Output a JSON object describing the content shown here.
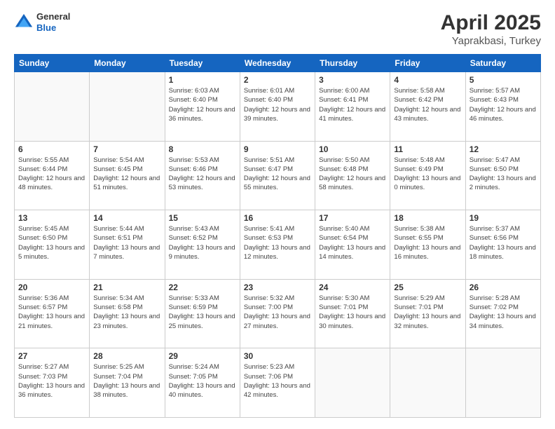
{
  "header": {
    "logo": {
      "general": "General",
      "blue": "Blue"
    },
    "title": "April 2025",
    "subtitle": "Yaprakbasi, Turkey"
  },
  "calendar": {
    "days_of_week": [
      "Sunday",
      "Monday",
      "Tuesday",
      "Wednesday",
      "Thursday",
      "Friday",
      "Saturday"
    ],
    "weeks": [
      [
        {
          "day": "",
          "empty": true
        },
        {
          "day": "",
          "empty": true
        },
        {
          "day": "1",
          "sunrise": "Sunrise: 6:03 AM",
          "sunset": "Sunset: 6:40 PM",
          "daylight": "Daylight: 12 hours and 36 minutes."
        },
        {
          "day": "2",
          "sunrise": "Sunrise: 6:01 AM",
          "sunset": "Sunset: 6:40 PM",
          "daylight": "Daylight: 12 hours and 39 minutes."
        },
        {
          "day": "3",
          "sunrise": "Sunrise: 6:00 AM",
          "sunset": "Sunset: 6:41 PM",
          "daylight": "Daylight: 12 hours and 41 minutes."
        },
        {
          "day": "4",
          "sunrise": "Sunrise: 5:58 AM",
          "sunset": "Sunset: 6:42 PM",
          "daylight": "Daylight: 12 hours and 43 minutes."
        },
        {
          "day": "5",
          "sunrise": "Sunrise: 5:57 AM",
          "sunset": "Sunset: 6:43 PM",
          "daylight": "Daylight: 12 hours and 46 minutes."
        }
      ],
      [
        {
          "day": "6",
          "sunrise": "Sunrise: 5:55 AM",
          "sunset": "Sunset: 6:44 PM",
          "daylight": "Daylight: 12 hours and 48 minutes."
        },
        {
          "day": "7",
          "sunrise": "Sunrise: 5:54 AM",
          "sunset": "Sunset: 6:45 PM",
          "daylight": "Daylight: 12 hours and 51 minutes."
        },
        {
          "day": "8",
          "sunrise": "Sunrise: 5:53 AM",
          "sunset": "Sunset: 6:46 PM",
          "daylight": "Daylight: 12 hours and 53 minutes."
        },
        {
          "day": "9",
          "sunrise": "Sunrise: 5:51 AM",
          "sunset": "Sunset: 6:47 PM",
          "daylight": "Daylight: 12 hours and 55 minutes."
        },
        {
          "day": "10",
          "sunrise": "Sunrise: 5:50 AM",
          "sunset": "Sunset: 6:48 PM",
          "daylight": "Daylight: 12 hours and 58 minutes."
        },
        {
          "day": "11",
          "sunrise": "Sunrise: 5:48 AM",
          "sunset": "Sunset: 6:49 PM",
          "daylight": "Daylight: 13 hours and 0 minutes."
        },
        {
          "day": "12",
          "sunrise": "Sunrise: 5:47 AM",
          "sunset": "Sunset: 6:50 PM",
          "daylight": "Daylight: 13 hours and 2 minutes."
        }
      ],
      [
        {
          "day": "13",
          "sunrise": "Sunrise: 5:45 AM",
          "sunset": "Sunset: 6:50 PM",
          "daylight": "Daylight: 13 hours and 5 minutes."
        },
        {
          "day": "14",
          "sunrise": "Sunrise: 5:44 AM",
          "sunset": "Sunset: 6:51 PM",
          "daylight": "Daylight: 13 hours and 7 minutes."
        },
        {
          "day": "15",
          "sunrise": "Sunrise: 5:43 AM",
          "sunset": "Sunset: 6:52 PM",
          "daylight": "Daylight: 13 hours and 9 minutes."
        },
        {
          "day": "16",
          "sunrise": "Sunrise: 5:41 AM",
          "sunset": "Sunset: 6:53 PM",
          "daylight": "Daylight: 13 hours and 12 minutes."
        },
        {
          "day": "17",
          "sunrise": "Sunrise: 5:40 AM",
          "sunset": "Sunset: 6:54 PM",
          "daylight": "Daylight: 13 hours and 14 minutes."
        },
        {
          "day": "18",
          "sunrise": "Sunrise: 5:38 AM",
          "sunset": "Sunset: 6:55 PM",
          "daylight": "Daylight: 13 hours and 16 minutes."
        },
        {
          "day": "19",
          "sunrise": "Sunrise: 5:37 AM",
          "sunset": "Sunset: 6:56 PM",
          "daylight": "Daylight: 13 hours and 18 minutes."
        }
      ],
      [
        {
          "day": "20",
          "sunrise": "Sunrise: 5:36 AM",
          "sunset": "Sunset: 6:57 PM",
          "daylight": "Daylight: 13 hours and 21 minutes."
        },
        {
          "day": "21",
          "sunrise": "Sunrise: 5:34 AM",
          "sunset": "Sunset: 6:58 PM",
          "daylight": "Daylight: 13 hours and 23 minutes."
        },
        {
          "day": "22",
          "sunrise": "Sunrise: 5:33 AM",
          "sunset": "Sunset: 6:59 PM",
          "daylight": "Daylight: 13 hours and 25 minutes."
        },
        {
          "day": "23",
          "sunrise": "Sunrise: 5:32 AM",
          "sunset": "Sunset: 7:00 PM",
          "daylight": "Daylight: 13 hours and 27 minutes."
        },
        {
          "day": "24",
          "sunrise": "Sunrise: 5:30 AM",
          "sunset": "Sunset: 7:01 PM",
          "daylight": "Daylight: 13 hours and 30 minutes."
        },
        {
          "day": "25",
          "sunrise": "Sunrise: 5:29 AM",
          "sunset": "Sunset: 7:01 PM",
          "daylight": "Daylight: 13 hours and 32 minutes."
        },
        {
          "day": "26",
          "sunrise": "Sunrise: 5:28 AM",
          "sunset": "Sunset: 7:02 PM",
          "daylight": "Daylight: 13 hours and 34 minutes."
        }
      ],
      [
        {
          "day": "27",
          "sunrise": "Sunrise: 5:27 AM",
          "sunset": "Sunset: 7:03 PM",
          "daylight": "Daylight: 13 hours and 36 minutes."
        },
        {
          "day": "28",
          "sunrise": "Sunrise: 5:25 AM",
          "sunset": "Sunset: 7:04 PM",
          "daylight": "Daylight: 13 hours and 38 minutes."
        },
        {
          "day": "29",
          "sunrise": "Sunrise: 5:24 AM",
          "sunset": "Sunset: 7:05 PM",
          "daylight": "Daylight: 13 hours and 40 minutes."
        },
        {
          "day": "30",
          "sunrise": "Sunrise: 5:23 AM",
          "sunset": "Sunset: 7:06 PM",
          "daylight": "Daylight: 13 hours and 42 minutes."
        },
        {
          "day": "",
          "empty": true
        },
        {
          "day": "",
          "empty": true
        },
        {
          "day": "",
          "empty": true
        }
      ]
    ]
  }
}
